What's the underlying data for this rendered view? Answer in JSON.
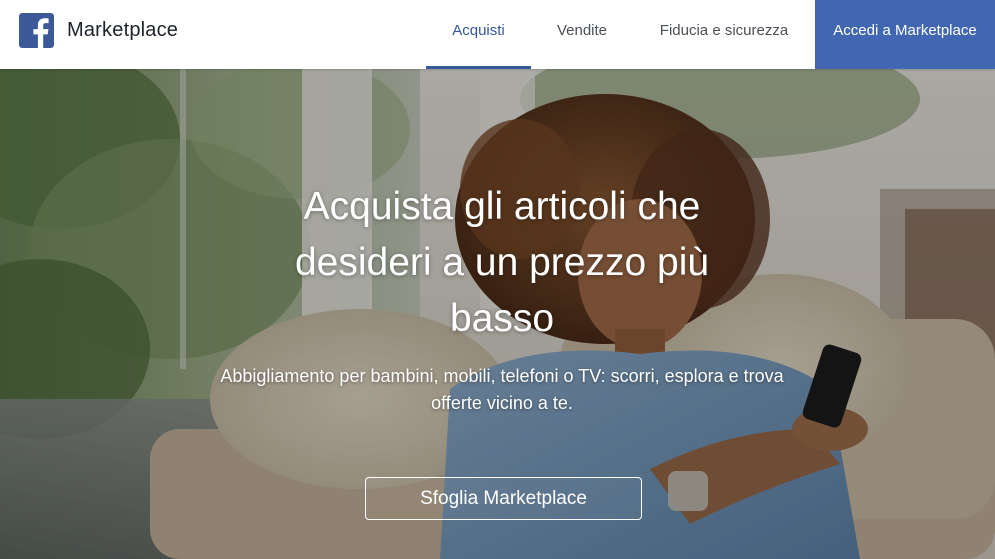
{
  "header": {
    "brand_name": "Marketplace",
    "logo_icon": "facebook-f-icon",
    "nav": [
      {
        "label": "Acquisti",
        "active": true
      },
      {
        "label": "Vendite",
        "active": false
      },
      {
        "label": "Fiducia e sicurezza",
        "active": false
      }
    ],
    "login_label": "Accedi a Marketplace"
  },
  "hero": {
    "title": "Acquista gli articoli che desideri a un prezzo più basso",
    "subtitle": "Abbigliamento per bambini, mobili, telefoni o TV: scorri, esplora e trova offerte vicino a te.",
    "cta_label": "Sfoglia Marketplace"
  },
  "colors": {
    "brand_blue": "#4267b2",
    "active_nav": "#365899",
    "nav_text": "#4b4f56",
    "hero_text": "#ffffff"
  }
}
